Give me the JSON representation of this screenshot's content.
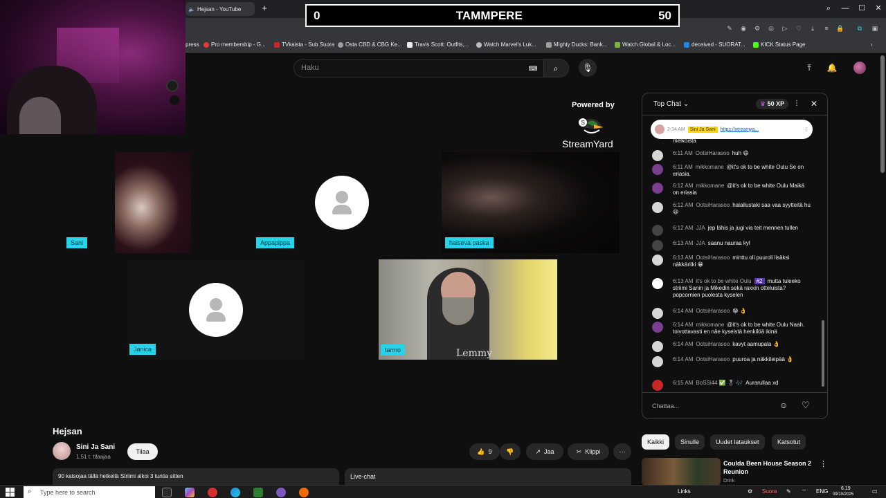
{
  "browser": {
    "tab_title": "Hejsan - YouTube",
    "tab_audio_icon": "speaker-icon",
    "new_tab_symbol": "+",
    "window_controls": {
      "minimize": "—",
      "maximize": "☐",
      "close": "✕"
    }
  },
  "bookmarks": [
    {
      "label": "press",
      "color": "#888888"
    },
    {
      "label": "Pro membership - G...",
      "color": "#e53935"
    },
    {
      "label": "TVkaista - Sub Suora",
      "color": "#c62828"
    },
    {
      "label": "Osta CBD & CBG Ke...",
      "color": "#9e9e9e"
    },
    {
      "label": "Travis Scott: Outfits,...",
      "color": "#eeeeee"
    },
    {
      "label": "Watch Marvel's Luk...",
      "color": "#bdbdbd"
    },
    {
      "label": "Mighty Ducks: Bank...",
      "color": "#9e9e9e"
    },
    {
      "label": "Watch Global & Loc...",
      "color": "#7cb342"
    },
    {
      "label": "deceived - SUORAT...",
      "color": "#1e88e5"
    },
    {
      "label": "KICK Status Page",
      "color": "#53fc18"
    }
  ],
  "scoreboard": {
    "left_score": "0",
    "title": "TAMMPERE",
    "right_score": "50"
  },
  "masthead": {
    "search_placeholder": "Haku"
  },
  "player": {
    "powered_by": "Powered by",
    "brand": "StreamYard",
    "participants": [
      {
        "name": "Sani"
      },
      {
        "name": "Appapippa"
      },
      {
        "name": "haiseva paska"
      },
      {
        "name": "Janica"
      },
      {
        "name": "tarmo"
      }
    ],
    "shirt_text": "Lemmy"
  },
  "video": {
    "title": "Hejsan",
    "channel_name": "Sini Ja Sani",
    "channel_subs": "1,51 t. tilaajaa",
    "subscribe_label": "Tilaa",
    "like_count": "9",
    "share_label": "Jaa",
    "clip_label": "Klippi",
    "more_label": "···",
    "description": "90 katsojaa tällä hetkellä  Striimi alkoi 3 tuntia sitten",
    "livechat_label": "Live-chat"
  },
  "chat": {
    "header_title": "Top Chat",
    "xp_badge": "50 XP",
    "pinned": {
      "time": "2:34 AM",
      "author": "Sini Ja Sani",
      "link": "https://streamya..."
    },
    "pinned_tail": "melkoista",
    "messages": [
      {
        "time": "6:11 AM",
        "author": "OotsiHarasoo",
        "text": "huh 😄",
        "color": "#d6d6d6"
      },
      {
        "time": "6:11 AM",
        "author": "mikkomane",
        "text": "@it's ok to be white Oulu Se on eriasia.",
        "color": "#7b3f8f"
      },
      {
        "time": "6:12 AM",
        "author": "mikkomane",
        "text": "@it's ok to be white Oulu Maikä on eriasia",
        "color": "#7b3f8f"
      },
      {
        "time": "6:12 AM",
        "author": "OotsiHarasoo",
        "text": "halailustaki saa vaa syytteitä hu 😃",
        "color": "#d6d6d6"
      },
      {
        "time": "6:12 AM",
        "author": "JJA",
        "text": "jep lähis ja jugi via teit mennen tullen",
        "color": "#444444"
      },
      {
        "time": "6:13 AM",
        "author": "JJA",
        "text": "saanu nauraa kyl",
        "color": "#444444"
      },
      {
        "time": "6:13 AM",
        "author": "OotsiHarasoo",
        "text": "minttu oli puuroli lisäksi näkkärilki 😁",
        "color": "#d6d6d6"
      },
      {
        "time": "6:13 AM",
        "author": "it's ok to be white Oulu",
        "badge": "#2",
        "text": "mutta tuleeko striimi Sanin ja Mikedin sekä raxxin otteluista? popcornien puolesta kyselen",
        "color": "#ffffff"
      },
      {
        "time": "6:14 AM",
        "author": "OotsiHarasoo",
        "text": "😁 👌",
        "color": "#d6d6d6"
      },
      {
        "time": "6:14 AM",
        "author": "mikkomane",
        "text": "@it's ok to be white Oulu Naah. toivottavasti en näe kyseistä henkilöä ikinä",
        "color": "#7b3f8f"
      },
      {
        "time": "6:14 AM",
        "author": "OotsiHarasoo",
        "text": "kavyt aamupala 👌",
        "color": "#d6d6d6"
      },
      {
        "time": "6:14 AM",
        "author": "OotsiHarasoo",
        "text": "puuroa ja näkkileipää 👌",
        "color": "#d6d6d6"
      },
      {
        "time": "6:15 AM",
        "author": "BoSSi44 ✅ 🎖 🎶",
        "text": "Aurarullaa xd",
        "color": "#c62828"
      }
    ],
    "input_placeholder": "Chattaa..."
  },
  "related": {
    "chips": [
      "Kaikki",
      "Sinulle",
      "Uudet lataukset",
      "Katsotut"
    ],
    "items": [
      {
        "title": "Coulda Been House Season 2 Reunion",
        "channel": "Drink"
      }
    ]
  },
  "taskbar": {
    "search_placeholder": "Type here to search",
    "links_label": "Links",
    "live_label": "Suora",
    "lang": "ENG",
    "time": "6.19",
    "date": "09/10/2025"
  },
  "colors": {
    "nametag": "#27d3e8",
    "scoreboard_border": "#ffffff",
    "chat_bg": "#0f0f0f"
  }
}
